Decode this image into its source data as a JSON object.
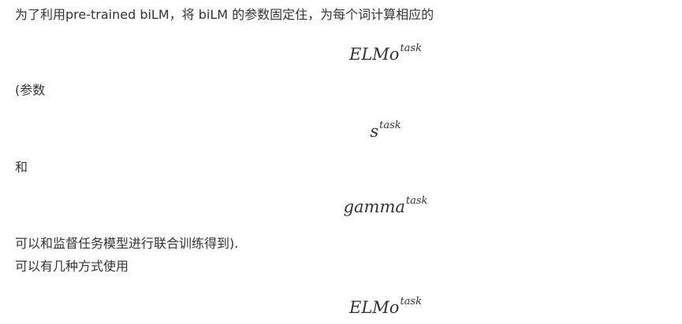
{
  "paragraphs": {
    "intro": "为了利用pre-trained biLM，将 biLM 的参数固定住，为每个词计算相应的",
    "params_open": "(参数",
    "and": "和",
    "supervised": "可以和监督任务模型进行联合训练得到).",
    "usage": "可以有几种方式使用"
  },
  "formulas": {
    "elmo_task_1": {
      "base": "ELMo",
      "sup": "task"
    },
    "s_task": {
      "base": "s",
      "sup": "task"
    },
    "gamma_task": {
      "base": "gamma",
      "sup": "task"
    },
    "elmo_task_2": {
      "base": "ELMo",
      "sup": "task"
    }
  }
}
